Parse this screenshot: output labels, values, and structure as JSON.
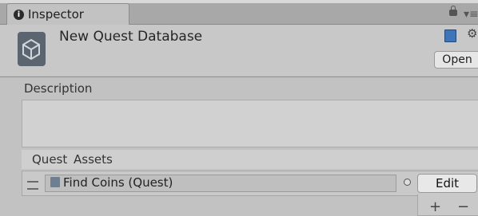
{
  "window": {
    "tab_label": "Inspector",
    "tab_icon": "info-icon",
    "lock_icon": "lock-icon",
    "menu_icon": "menu-icon"
  },
  "header": {
    "title": "New Quest Database",
    "asset_icon": "unity-asset-icon",
    "book_icon": "book-icon",
    "gear_icon": "gear-icon",
    "open_label": "Open"
  },
  "description": {
    "label": "Description",
    "value": ""
  },
  "quest_assets": {
    "label": "Quest Assets",
    "items": [
      {
        "label": "Find Coins (Quest)",
        "icon": "quest-asset-icon",
        "edit_label": "Edit"
      }
    ],
    "add_label": "+",
    "remove_label": "−"
  }
}
